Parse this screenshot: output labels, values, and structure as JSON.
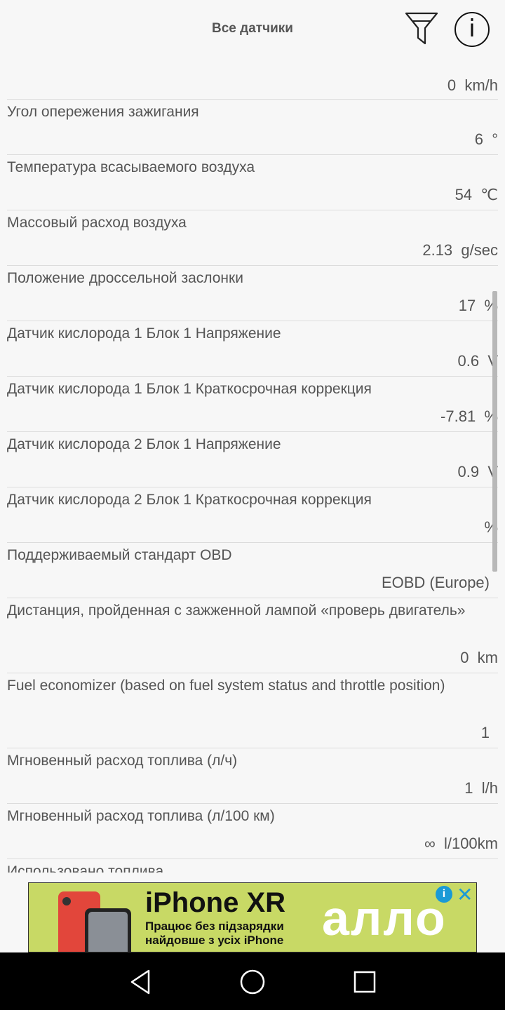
{
  "header": {
    "title": "Все датчики",
    "filter_icon": "filter-icon",
    "info_icon": "info-icon",
    "info_glyph": "i"
  },
  "sensors": [
    {
      "name": "",
      "value": "0",
      "unit": "km/h"
    },
    {
      "name": "Угол опережения зажигания",
      "value": "6",
      "unit": "°"
    },
    {
      "name": "Температура всасываемого воздуха",
      "value": "54",
      "unit": "℃"
    },
    {
      "name": "Массовый расход воздуха",
      "value": "2.13",
      "unit": "g/sec"
    },
    {
      "name": "Положение дроссельной заслонки",
      "value": "17",
      "unit": "%"
    },
    {
      "name": "Датчик кислорода 1 Блок 1 Напряжение",
      "value": "0.6",
      "unit": "V"
    },
    {
      "name": "Датчик кислорода 1 Блок 1 Краткосрочная коррекция",
      "value": "-7.81",
      "unit": "%"
    },
    {
      "name": "Датчик кислорода 2 Блок 1 Напряжение",
      "value": "0.9",
      "unit": "V"
    },
    {
      "name": "Датчик кислорода 2 Блок 1 Краткосрочная коррекция",
      "value": "",
      "unit": "%"
    },
    {
      "name": "Поддерживаемый стандарт OBD",
      "value": "EOBD (Europe)",
      "unit": ""
    },
    {
      "name": "Дистанция, пройденная с зажженной лампой «проверь двигатель»",
      "value": "0",
      "unit": "km"
    },
    {
      "name": "Fuel economizer (based on fuel system status and throttle position)",
      "value": "1",
      "unit": ""
    },
    {
      "name": "Мгновенный расход топлива (л/ч)",
      "value": "1",
      "unit": "l/h"
    },
    {
      "name": "Мгновенный расход топлива (л/100 км)",
      "value": "∞",
      "unit": "l/100km"
    },
    {
      "name": "Использовано топлива",
      "value": "",
      "unit": ""
    }
  ],
  "ad": {
    "headline": "iPhone XR",
    "line1": "Працює без підзарядки",
    "line2": "найдовше з усіх iPhone",
    "brand": "алло",
    "info_glyph": "i",
    "close_glyph": "✕"
  },
  "navbar": {
    "back": "back-icon",
    "home": "home-icon",
    "recents": "recents-icon"
  }
}
